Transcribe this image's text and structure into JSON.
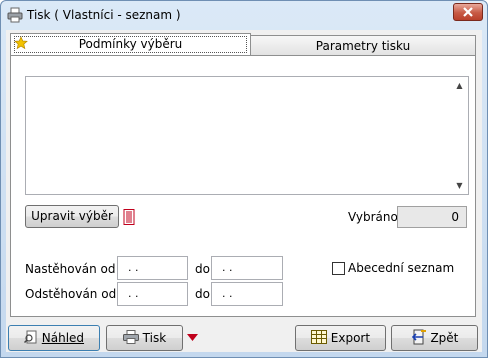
{
  "window": {
    "title": "Tisk ( Vlastníci - seznam )",
    "close_icon": "close-icon"
  },
  "tabs": [
    {
      "label": "Podmínky výběru",
      "icon": "star-icon",
      "selected": true
    },
    {
      "label": "Parametry tisku",
      "selected": false
    }
  ],
  "filter": {
    "edit_button": "Upravit výběr",
    "selected_label": "Vybráno",
    "selected_value": "0",
    "moved_in_label": "Nastěhován od",
    "moved_in_from": " .  .",
    "moved_in_to_label": "do",
    "moved_in_to": " .  .",
    "moved_out_label": "Odstěhován od",
    "moved_out_from": " .  .",
    "moved_out_to_label": "do",
    "moved_out_to": " .  .",
    "alphabetical_label": "Abecední seznam",
    "alphabetical_checked": false
  },
  "footer": {
    "preview_label": "Náhled",
    "print_label": "Tisk",
    "export_label": "Export",
    "back_label": "Zpět"
  },
  "colors": {
    "accent_red": "#c0001c",
    "titlebar": "#dbe9f7"
  }
}
